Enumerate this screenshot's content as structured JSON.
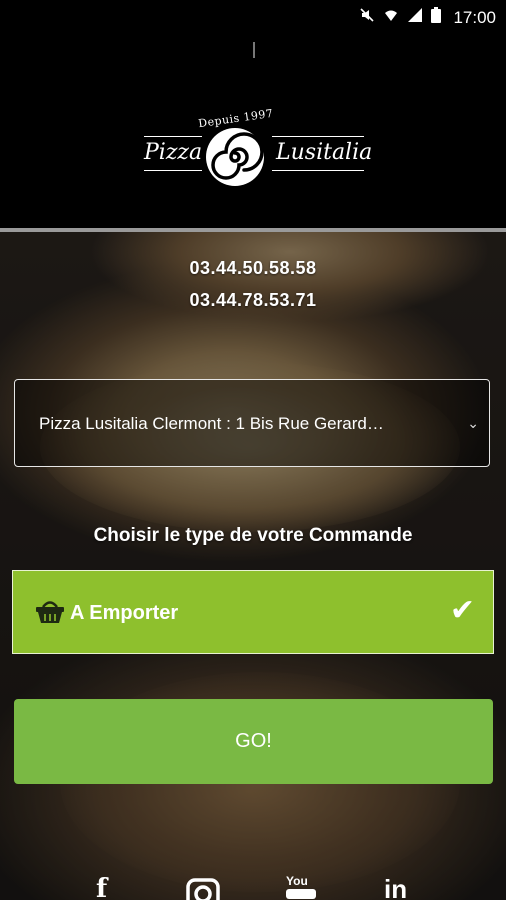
{
  "status_bar": {
    "time": "17:00",
    "icons": [
      "mute-icon",
      "wifi-icon",
      "signal-icon",
      "battery-icon"
    ]
  },
  "logo": {
    "tagline": "Depuis 1997",
    "word_left": "Pizza",
    "word_right": "Lusitalia"
  },
  "contact": {
    "phone_1": "03.44.50.58.58",
    "phone_2": "03.44.78.53.71"
  },
  "store_select": {
    "selected": "Pizza Lusitalia Clermont : 1 Bis Rue Gerard…"
  },
  "order": {
    "title": "Choisir le type de votre Commande",
    "option_label": "A Emporter",
    "option_selected": true
  },
  "go_button": {
    "label": "GO!"
  },
  "social": [
    "facebook-icon",
    "instagram-icon",
    "youtube-icon",
    "linkedin-icon"
  ],
  "colors": {
    "accent_green": "#8ec02d",
    "button_green": "#7ab944",
    "header_bg": "#000000"
  }
}
